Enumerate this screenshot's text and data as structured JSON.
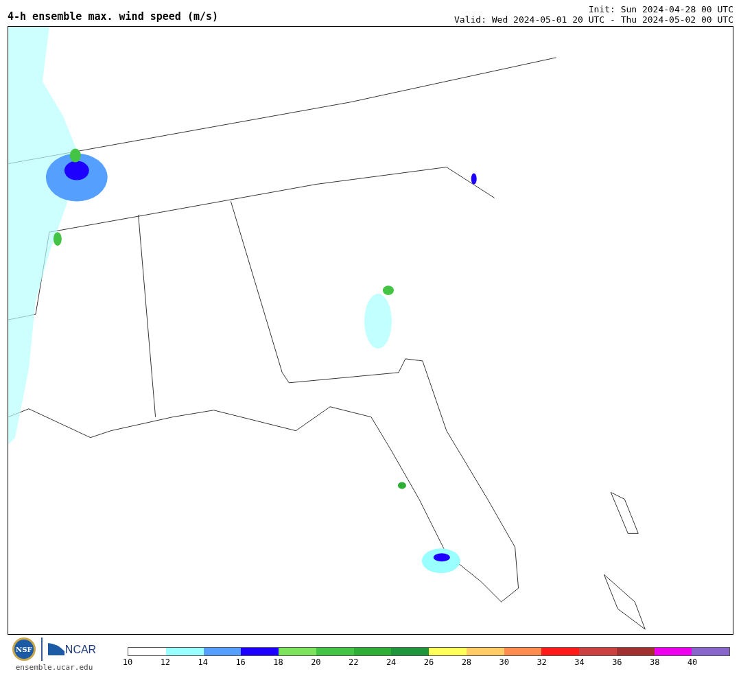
{
  "header": {
    "title": "4-h ensemble max. wind speed (m/s)",
    "init": "Init: Sun 2024-04-28 00 UTC",
    "valid": "Valid: Wed 2024-05-01 20 UTC - Thu 2024-05-02 00 UTC"
  },
  "footer": {
    "nsf_logo": "NSF",
    "ncar_logo": "NCAR",
    "website": "ensemble.ucar.edu"
  },
  "legend": {
    "bins": [
      {
        "color": "#ffffff"
      },
      {
        "color": "#99ffff"
      },
      {
        "color": "#559fff"
      },
      {
        "color": "#1e00ff"
      },
      {
        "color": "#7ce35c"
      },
      {
        "color": "#44c444"
      },
      {
        "color": "#2fae36"
      },
      {
        "color": "#1f963c"
      },
      {
        "color": "#ffff5c"
      },
      {
        "color": "#ffcc66"
      },
      {
        "color": "#ff8c4f"
      },
      {
        "color": "#ff1a1a"
      },
      {
        "color": "#cc4040"
      },
      {
        "color": "#a33030"
      },
      {
        "color": "#ee00ee"
      },
      {
        "color": "#8866cc"
      }
    ],
    "ticks": [
      "10",
      "12",
      "14",
      "16",
      "18",
      "20",
      "22",
      "24",
      "26",
      "28",
      "30",
      "32",
      "34",
      "36",
      "38",
      "40"
    ]
  }
}
